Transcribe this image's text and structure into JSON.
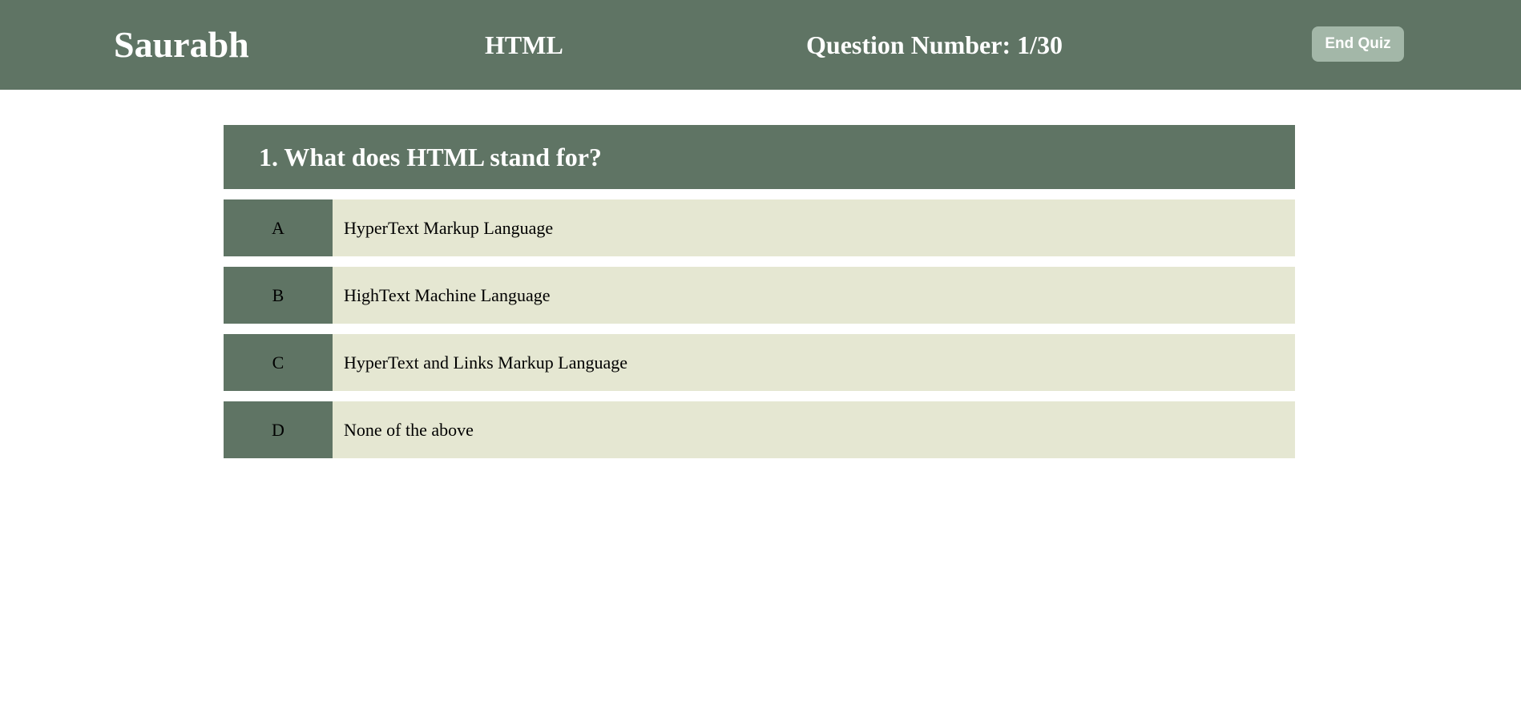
{
  "header": {
    "username": "Saurabh",
    "subject": "HTML",
    "question_number": "Question Number: 1/30",
    "end_quiz_label": "End Quiz"
  },
  "question": {
    "text": "1. What does HTML stand for?"
  },
  "options": [
    {
      "letter": "A",
      "text": "HyperText Markup Language"
    },
    {
      "letter": "B",
      "text": "HighText Machine Language"
    },
    {
      "letter": "C",
      "text": "HyperText and Links Markup Language"
    },
    {
      "letter": "D",
      "text": "None of the above"
    }
  ],
  "colors": {
    "primary": "#5f7464",
    "button": "#a3b7a8",
    "option_bg": "#e5e7d2"
  }
}
